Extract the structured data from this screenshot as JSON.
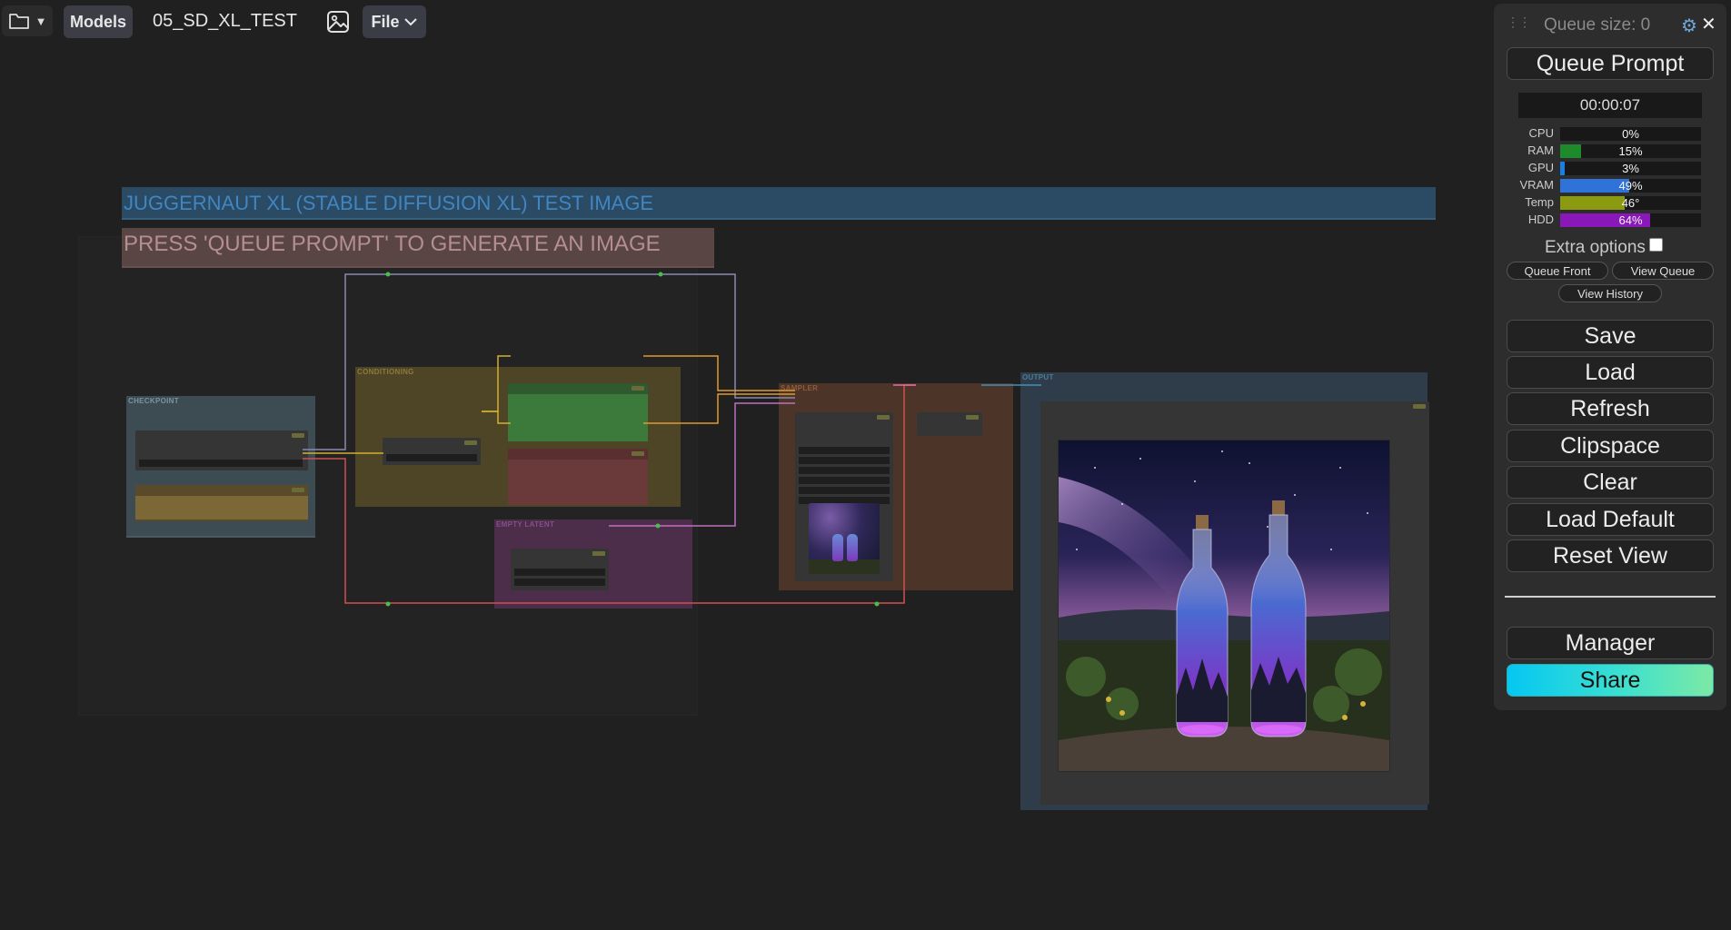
{
  "topbar": {
    "models_label": "Models",
    "workflow_title": "05_SD_XL_TEST",
    "file_menu_label": "File"
  },
  "canvas": {
    "note_title": "JUGGERNAUT XL (STABLE DIFFUSION XL) TEST IMAGE",
    "note_instruction": "PRESS 'QUEUE PROMPT' TO GENERATE AN IMAGE",
    "groups": {
      "checkpoint": "CHECKPOINT",
      "conditioning": "CONDITIONING",
      "empty_latent": "EMPTY LATENT",
      "sampler": "SAMPLER",
      "output": "OUTPUT"
    }
  },
  "panel": {
    "queue_size": "Queue size: 0",
    "queue_prompt": "Queue Prompt",
    "timer": "00:00:07",
    "monitors": [
      {
        "label": "CPU",
        "value": "0%",
        "fill": 0,
        "color": "#1a8f3a"
      },
      {
        "label": "RAM",
        "value": "15%",
        "fill": 15,
        "color": "#1d8a2c"
      },
      {
        "label": "GPU",
        "value": "3%",
        "fill": 3,
        "color": "#1a7fe0"
      },
      {
        "label": "VRAM",
        "value": "49%",
        "fill": 49,
        "color": "#2f72d8"
      },
      {
        "label": "Temp",
        "value": "46°",
        "fill": 46,
        "color": "#8c9a12"
      },
      {
        "label": "HDD",
        "value": "64%",
        "fill": 64,
        "color": "#8a18b8"
      }
    ],
    "extra_options": "Extra options",
    "queue_front": "Queue Front",
    "view_queue": "View Queue",
    "view_history": "View History",
    "save": "Save",
    "load": "Load",
    "refresh": "Refresh",
    "clipspace": "Clipspace",
    "clear": "Clear",
    "load_default": "Load Default",
    "reset_view": "Reset View",
    "manager": "Manager",
    "share": "Share"
  }
}
